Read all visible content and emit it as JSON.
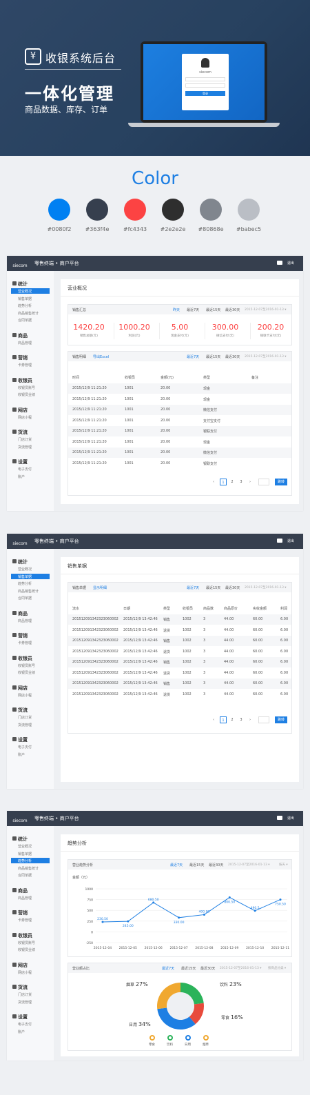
{
  "hero": {
    "logo_icon": "¥",
    "logo_text": "收银系统后台",
    "title": "一体化管理",
    "subtitle": "商品数据、库存、订单",
    "login_brand": "siecom",
    "login_button": "登录"
  },
  "colors": {
    "title": "Color",
    "swatches": [
      {
        "hex": "#0080f2",
        "label": "#0080f2"
      },
      {
        "hex": "#363f4e",
        "label": "#363f4e"
      },
      {
        "hex": "#fc4343",
        "label": "#fc4343"
      },
      {
        "hex": "#2e2e2e",
        "label": "#2e2e2e"
      },
      {
        "hex": "#80868e",
        "label": "#80868e"
      },
      {
        "hex": "#babec5",
        "label": "#babec5"
      }
    ]
  },
  "app": {
    "brand": "siecom",
    "title": "零售终端 • 商户平台",
    "exit": "退出"
  },
  "sidebar": {
    "groups": [
      {
        "label": "统计",
        "items": [
          "营业概况",
          "销售单据",
          "趋势分析",
          "商品销售统计",
          "合同单据"
        ]
      },
      {
        "label": "商品",
        "items": [
          "商品管理"
        ]
      },
      {
        "label": "营销",
        "items": [
          "卡券管理"
        ]
      },
      {
        "label": "收银员",
        "items": [
          "收银员账号",
          "收银员业绩"
        ]
      },
      {
        "label": "网店",
        "items": [
          "网店小程"
        ]
      },
      {
        "label": "货流",
        "items": [
          "门店订货",
          "货流管理"
        ]
      },
      {
        "label": "设置",
        "items": [
          "电子支付",
          "账户"
        ]
      }
    ]
  },
  "p1": {
    "title": "营业概况",
    "summary": {
      "label": "销售汇总",
      "filters": [
        "昨天",
        "最近7天",
        "最近15天",
        "最近30天"
      ],
      "date": "2015-12-07至2016-01-13 ▾",
      "stats": [
        {
          "value": "1420.20",
          "label": "销售总额(元)"
        },
        {
          "value": "1000.20",
          "label": "利润(元)"
        },
        {
          "value": "5.00",
          "label": "现金支付(元)"
        },
        {
          "value": "300.00",
          "label": "微信支付(元)"
        },
        {
          "value": "200.20",
          "label": "银联卡支付(元)"
        }
      ]
    },
    "detail": {
      "label": "销售明细",
      "export": "导出Excel",
      "filters": [
        "最近7天",
        "最近15天",
        "最近30天"
      ],
      "date": "2015-12-07至2016-01-13 ▾",
      "headers": [
        "时间",
        "收银员",
        "金额(元)",
        "类型",
        "备注"
      ],
      "rows": [
        [
          "2015/12/9 11:21:20",
          "1001",
          "20.00",
          "现金",
          ""
        ],
        [
          "2015/12/9 11:21:20",
          "1001",
          "20.00",
          "现金",
          ""
        ],
        [
          "2015/12/9 11:21:20",
          "1001",
          "20.00",
          "微信支付",
          ""
        ],
        [
          "2015/12/9 11:21:20",
          "1001",
          "20.00",
          "支付宝支付",
          ""
        ],
        [
          "2015/12/9 11:21:20",
          "1001",
          "20.00",
          "银联支付",
          ""
        ],
        [
          "2015/12/9 11:21:20",
          "1001",
          "20.00",
          "现金",
          ""
        ],
        [
          "2015/12/9 11:21:20",
          "1001",
          "20.00",
          "微信支付",
          ""
        ],
        [
          "2015/12/9 11:21:20",
          "1001",
          "20.00",
          "银联支付",
          ""
        ]
      ]
    },
    "pager": {
      "prev": "‹",
      "pages": [
        "1",
        "2",
        "3"
      ],
      "next": "›",
      "jump": "跳转"
    }
  },
  "p2": {
    "title": "销售单据",
    "bar": {
      "label": "销售单据",
      "link": "显示明细",
      "filters": [
        "最近7天",
        "最近15天",
        "最近30天"
      ],
      "date": "2015-12-07至2016-01-13 ▾"
    },
    "headers": [
      "流水",
      "日期",
      "类型",
      "收银员",
      "商品数",
      "商品原价",
      "实收金额",
      "利润"
    ],
    "rows": [
      [
        "201512091342323060002",
        "2015/12/9 13:42:46",
        "销售",
        "1002",
        "3",
        "44.00",
        "60.00",
        "6.00"
      ],
      [
        "201512091342323060002",
        "2015/12/9 13:42:46",
        "退货",
        "1002",
        "3",
        "44.00",
        "60.00",
        "6.00"
      ],
      [
        "201512091342323060002",
        "2015/12/9 13:42:46",
        "销售",
        "1002",
        "3",
        "44.00",
        "60.00",
        "6.00"
      ],
      [
        "201512091342323060002",
        "2015/12/9 13:42:46",
        "退货",
        "1002",
        "3",
        "44.00",
        "60.00",
        "6.00"
      ],
      [
        "201512091342323060002",
        "2015/12/9 13:42:46",
        "销售",
        "1002",
        "3",
        "44.00",
        "60.00",
        "6.00"
      ],
      [
        "201512091342323060002",
        "2015/12/9 13:42:46",
        "退货",
        "1002",
        "3",
        "44.00",
        "60.00",
        "6.00"
      ],
      [
        "201512091342323060002",
        "2015/12/9 13:42:46",
        "销售",
        "1002",
        "3",
        "44.00",
        "60.00",
        "6.00"
      ],
      [
        "201512091342323060002",
        "2015/12/9 13:42:46",
        "退货",
        "1002",
        "3",
        "44.00",
        "60.00",
        "6.00"
      ]
    ],
    "pager": {
      "prev": "‹",
      "pages": [
        "1",
        "2",
        "3"
      ],
      "next": "›",
      "jump": "跳转"
    }
  },
  "p3": {
    "title": "趋势分析",
    "trend_bar": {
      "label": "营业趋势分析",
      "filters": [
        "最近7天",
        "最近15天",
        "最近30天"
      ],
      "date": "2015-12-07至2016-01-13 ▾",
      "unit_select": "按天 ▾"
    },
    "unit": "金额（元）",
    "share_bar": {
      "label": "营业额占比",
      "filters": [
        "最近7天",
        "最近15天",
        "最近30天"
      ],
      "date": "2015-12-07至2016-01-13 ▾",
      "cat_select": "按商品分类 ▾"
    }
  },
  "chart_data": [
    {
      "type": "line",
      "x": [
        "2015-12-04",
        "2015-12-05",
        "2015-12-06",
        "2015-12-07",
        "2015-12-08",
        "2015-12-09",
        "2015-12-10",
        "2015-12-11"
      ],
      "series": [
        {
          "values": [
            230.5,
            245.0,
            680.5,
            330.0,
            400.0,
            800.5,
            490.5,
            750.5
          ],
          "labels": [
            "230.50",
            "245.00",
            "680.50",
            "330.00",
            "400.00",
            "800.50",
            "490.5",
            "750.50"
          ]
        }
      ],
      "ylabel": "金额（元）",
      "ylim": [
        -250,
        1000
      ],
      "yticks": [
        -250,
        0,
        250,
        500,
        750,
        1000
      ],
      "color": "#1e7fe3",
      "grid": true
    },
    {
      "type": "pie",
      "slices": [
        {
          "name": "饮料",
          "value": 23,
          "label": "23%",
          "color": "#e84b3c"
        },
        {
          "name": "零食",
          "value": 16,
          "label": "16%",
          "color": "#e84b3c"
        },
        {
          "name": "日用",
          "value": 34,
          "label": "34%",
          "color": "#1e7fe3"
        },
        {
          "name": "烟草",
          "value": 27,
          "label": "27%",
          "color": "#f0a830"
        }
      ],
      "legend": [
        {
          "name": "零食",
          "color": "#f0a830"
        },
        {
          "name": "饮料",
          "color": "#2bb35a"
        },
        {
          "name": "日用",
          "color": "#1e7fe3"
        },
        {
          "name": "烟草",
          "color": "#f0a830"
        }
      ]
    }
  ]
}
